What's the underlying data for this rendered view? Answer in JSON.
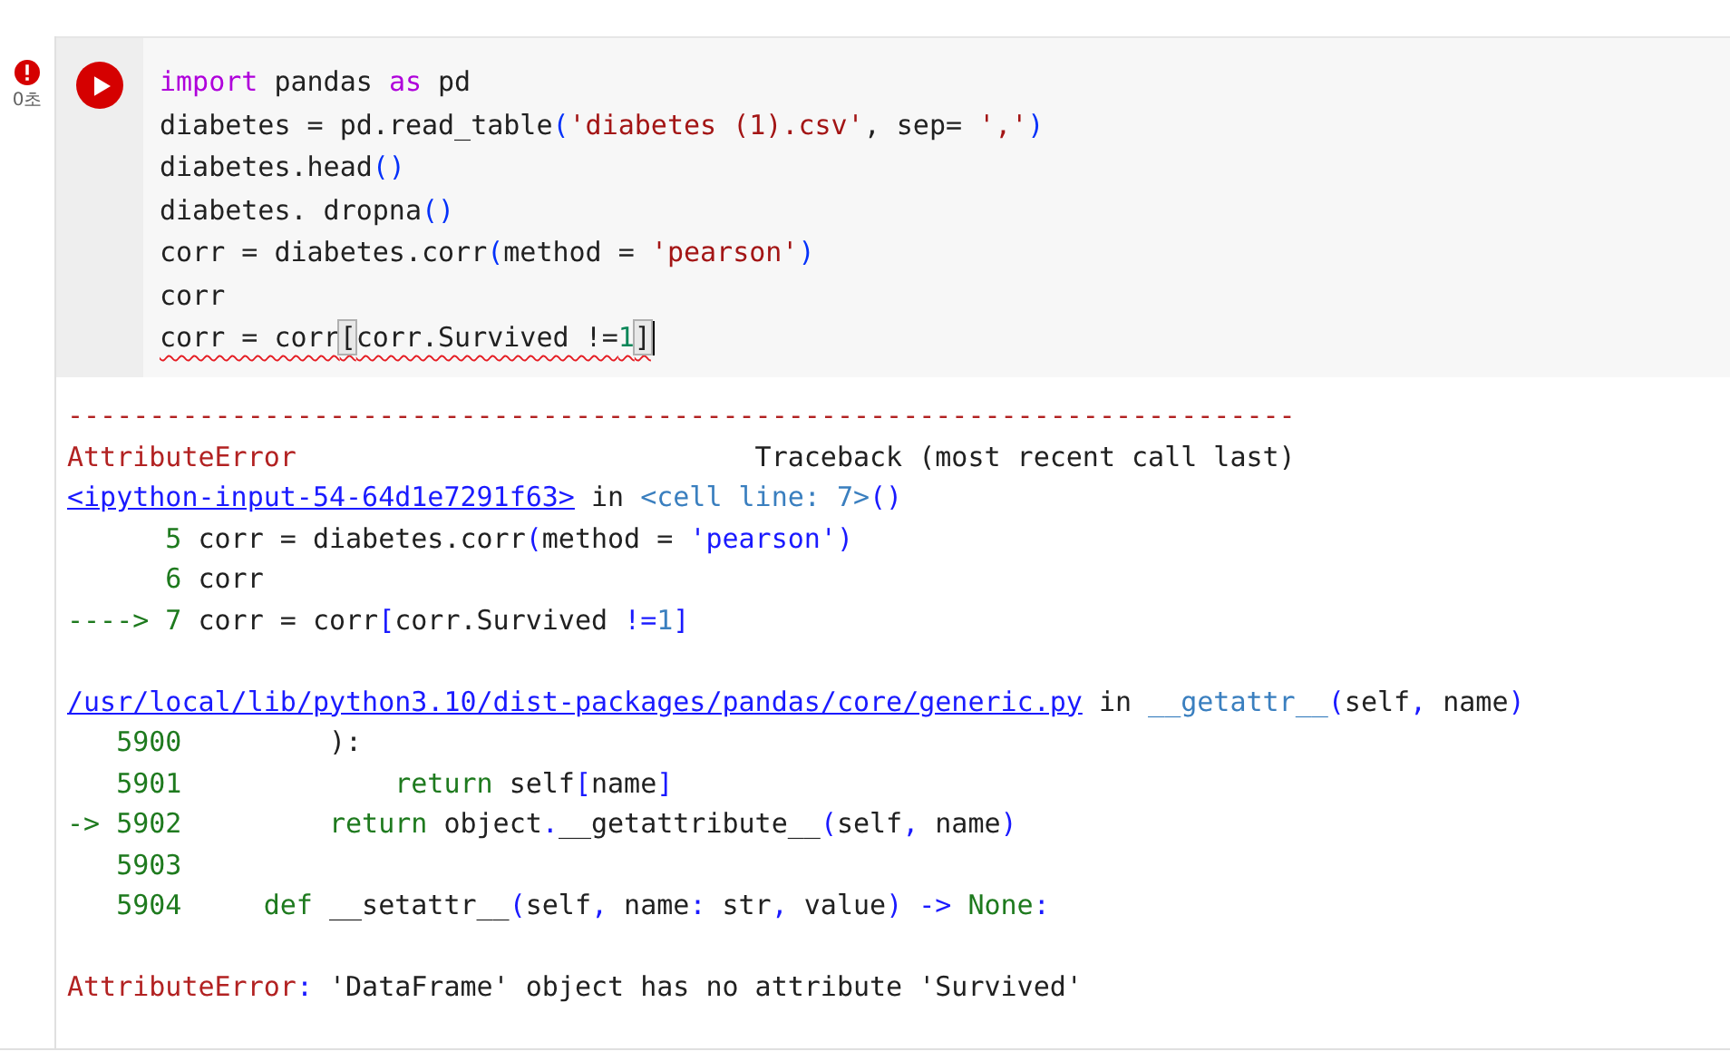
{
  "cell": {
    "error": true,
    "time": "0초",
    "code": [
      {
        "tokens": [
          {
            "kind": "kw",
            "text": "import"
          },
          {
            "kind": "plain",
            "text": " pandas "
          },
          {
            "kind": "kw",
            "text": "as"
          },
          {
            "kind": "plain",
            "text": " pd"
          }
        ]
      },
      {
        "tokens": [
          {
            "kind": "plain",
            "text": "diabetes = pd.read_table"
          },
          {
            "kind": "br",
            "text": "("
          },
          {
            "kind": "str",
            "text": "'diabetes (1).csv'"
          },
          {
            "kind": "plain",
            "text": ", sep= "
          },
          {
            "kind": "str",
            "text": "','"
          },
          {
            "kind": "br",
            "text": ")"
          }
        ]
      },
      {
        "tokens": [
          {
            "kind": "plain",
            "text": "diabetes.head"
          },
          {
            "kind": "br",
            "text": "()"
          }
        ]
      },
      {
        "tokens": [
          {
            "kind": "plain",
            "text": "diabetes. dropna"
          },
          {
            "kind": "br",
            "text": "()"
          }
        ]
      },
      {
        "tokens": [
          {
            "kind": "plain",
            "text": "corr = diabetes.corr"
          },
          {
            "kind": "br",
            "text": "("
          },
          {
            "kind": "plain",
            "text": "method = "
          },
          {
            "kind": "str",
            "text": "'pearson'"
          },
          {
            "kind": "br",
            "text": ")"
          }
        ]
      },
      {
        "tokens": [
          {
            "kind": "plain",
            "text": "corr"
          }
        ]
      },
      {
        "squiggle": true,
        "cursor": true,
        "tokens": [
          {
            "kind": "plain",
            "text": "corr = corr"
          },
          {
            "kind": "match",
            "text": "["
          },
          {
            "kind": "plain",
            "text": "corr.Survived !="
          },
          {
            "kind": "num",
            "text": "1"
          },
          {
            "kind": "match",
            "text": "]"
          }
        ]
      }
    ],
    "output": [
      [
        {
          "tokens": [
            {
              "kind": "err",
              "text": "---------------------------------------------------------------------------"
            }
          ]
        },
        {
          "tokens": [
            {
              "kind": "err",
              "text": "AttributeError"
            },
            {
              "kind": "plain",
              "text": "                            Traceback (most recent call last)"
            }
          ]
        },
        {
          "tokens": [
            {
              "kind": "link",
              "text": "<ipython-input-54-64d1e7291f63>"
            },
            {
              "kind": "plain",
              "text": " in "
            },
            {
              "kind": "cell",
              "text": "<cell line: 7>"
            },
            {
              "kind": "bl",
              "text": "()"
            }
          ]
        },
        {
          "tokens": [
            {
              "kind": "lineno",
              "text": "      5 "
            },
            {
              "kind": "plain",
              "text": "corr = diabetes.corr"
            },
            {
              "kind": "bl",
              "text": "("
            },
            {
              "kind": "plain",
              "text": "method = "
            },
            {
              "kind": "bl",
              "text": "'pearson')"
            }
          ]
        },
        {
          "tokens": [
            {
              "kind": "lineno",
              "text": "      6 "
            },
            {
              "kind": "plain",
              "text": "corr"
            }
          ]
        },
        {
          "tokens": [
            {
              "kind": "lineno",
              "text": "----> 7 "
            },
            {
              "kind": "plain",
              "text": "corr = corr"
            },
            {
              "kind": "bl",
              "text": "["
            },
            {
              "kind": "plain",
              "text": "corr.Survived "
            },
            {
              "kind": "bl",
              "text": "!="
            },
            {
              "kind": "cell",
              "text": "1"
            },
            {
              "kind": "bl",
              "text": "]"
            }
          ]
        }
      ],
      [
        {
          "tokens": [
            {
              "kind": "link",
              "text": "/usr/local/lib/python3.10/dist-packages/pandas/core/generic.py"
            },
            {
              "kind": "plain",
              "text": " in "
            },
            {
              "kind": "cell",
              "text": "__getattr__"
            },
            {
              "kind": "bl",
              "text": "("
            },
            {
              "kind": "plain",
              "text": "self"
            },
            {
              "kind": "bl",
              "text": ","
            },
            {
              "kind": "plain",
              "text": " name"
            },
            {
              "kind": "bl",
              "text": ")"
            }
          ]
        },
        {
          "tokens": [
            {
              "kind": "lineno",
              "text": "   5900 "
            },
            {
              "kind": "plain",
              "text": "        ):"
            }
          ]
        },
        {
          "tokens": [
            {
              "kind": "lineno",
              "text": "   5901             "
            },
            {
              "kind": "lineno",
              "text": "return"
            },
            {
              "kind": "plain",
              "text": " self"
            },
            {
              "kind": "bl",
              "text": "["
            },
            {
              "kind": "plain",
              "text": "name"
            },
            {
              "kind": "bl",
              "text": "]"
            }
          ]
        },
        {
          "tokens": [
            {
              "kind": "lineno",
              "text": "-> 5902         return"
            },
            {
              "kind": "plain",
              "text": " object"
            },
            {
              "kind": "bl",
              "text": "."
            },
            {
              "kind": "plain",
              "text": "__getattribute__"
            },
            {
              "kind": "bl",
              "text": "("
            },
            {
              "kind": "plain",
              "text": "self"
            },
            {
              "kind": "bl",
              "text": ","
            },
            {
              "kind": "plain",
              "text": " name"
            },
            {
              "kind": "bl",
              "text": ")"
            }
          ]
        },
        {
          "tokens": [
            {
              "kind": "lineno",
              "text": "   5903"
            }
          ]
        },
        {
          "tokens": [
            {
              "kind": "lineno",
              "text": "   5904     def"
            },
            {
              "kind": "plain",
              "text": " __setattr__"
            },
            {
              "kind": "bl",
              "text": "("
            },
            {
              "kind": "plain",
              "text": "self"
            },
            {
              "kind": "bl",
              "text": ","
            },
            {
              "kind": "plain",
              "text": " name"
            },
            {
              "kind": "bl",
              "text": ":"
            },
            {
              "kind": "plain",
              "text": " str"
            },
            {
              "kind": "bl",
              "text": ","
            },
            {
              "kind": "plain",
              "text": " value"
            },
            {
              "kind": "bl",
              "text": ")"
            },
            {
              "kind": "bl",
              "text": " ->"
            },
            {
              "kind": "lineno",
              "text": " None"
            },
            {
              "kind": "bl",
              "text": ":"
            }
          ]
        }
      ],
      [
        {
          "tokens": [
            {
              "kind": "err",
              "text": "AttributeError"
            },
            {
              "kind": "bl",
              "text": ":"
            },
            {
              "kind": "plain",
              "text": " 'DataFrame' object has no attribute 'Survived'"
            }
          ]
        }
      ]
    ]
  }
}
